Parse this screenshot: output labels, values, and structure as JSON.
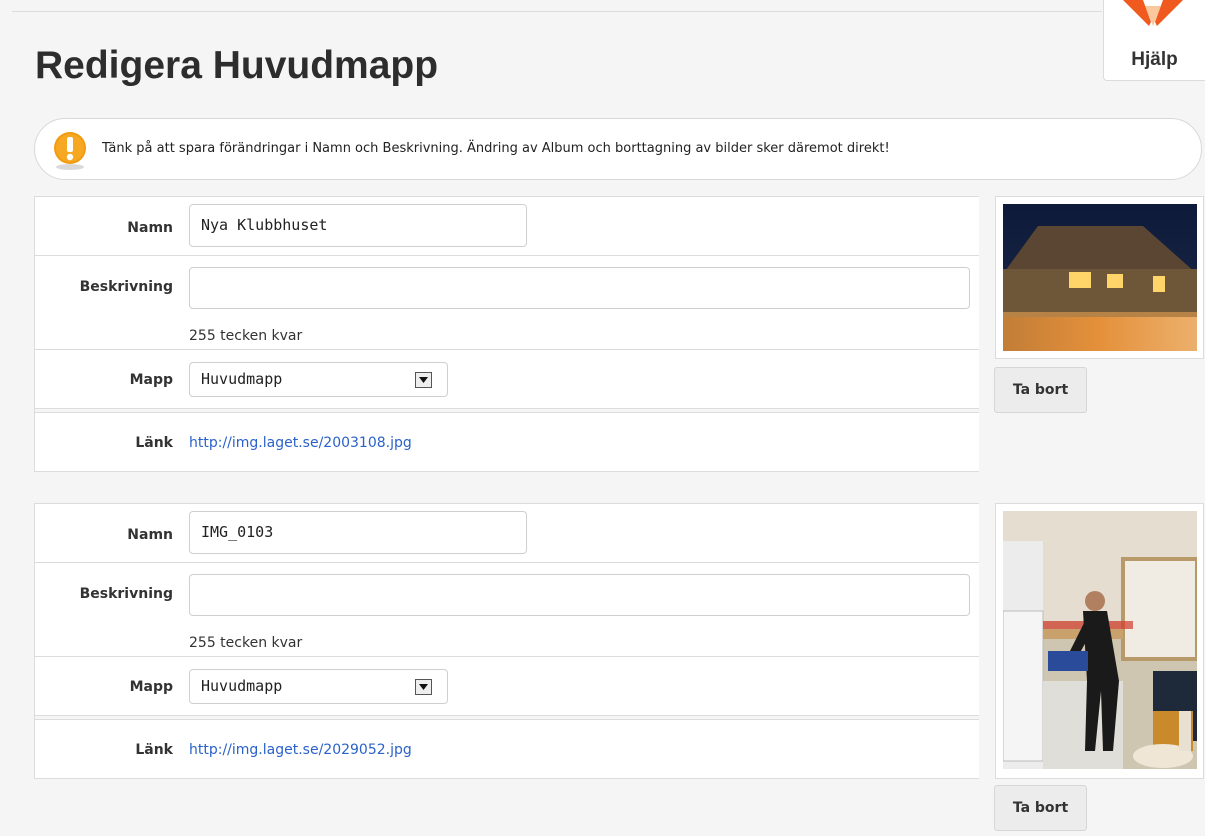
{
  "page": {
    "title": "Redigera Huvudmapp",
    "help_label": "Hjälp"
  },
  "notice": {
    "text": "Tänk på att spara förändringar i Namn och Beskrivning. Ändring av Album och borttagning av bilder sker däremot direkt!",
    "icon": "exclamation-icon"
  },
  "labels": {
    "name": "Namn",
    "description": "Beskrivning",
    "folder": "Mapp",
    "link": "Länk",
    "remove": "Ta bort"
  },
  "photos": [
    {
      "name": "Nya Klubbhuset",
      "description": "",
      "chars_left": "255 tecken kvar",
      "folder": "Huvudmapp",
      "link": "http://img.laget.se/2003108.jpg"
    },
    {
      "name": "IMG_0103",
      "description": "",
      "chars_left": "255 tecken kvar",
      "folder": "Huvudmapp",
      "link": "http://img.laget.se/2029052.jpg"
    }
  ],
  "colors": {
    "link": "#2a62c9",
    "notice_icon": "#f29b12",
    "help_logo": "#f05a1e"
  }
}
